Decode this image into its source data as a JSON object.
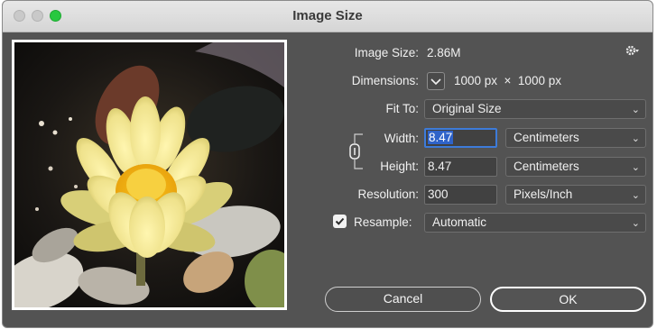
{
  "window": {
    "title": "Image Size"
  },
  "info": {
    "image_size_label": "Image Size:",
    "image_size_value": "2.86M",
    "dimensions_label": "Dimensions:",
    "dimensions_value": "1000 px  ×  1000 px"
  },
  "fit_to": {
    "label": "Fit To:",
    "value": "Original Size"
  },
  "width": {
    "label": "Width:",
    "value": "8.47",
    "unit": "Centimeters"
  },
  "height": {
    "label": "Height:",
    "value": "8.47",
    "unit": "Centimeters"
  },
  "resolution": {
    "label": "Resolution:",
    "value": "300",
    "unit": "Pixels/Inch"
  },
  "resample": {
    "label": "Resample:",
    "checked": true,
    "value": "Automatic"
  },
  "buttons": {
    "cancel": "Cancel",
    "ok": "OK"
  },
  "icons": {
    "gear": "gear-icon",
    "link": "link-constrain-icon",
    "chevron": "chevron-down-icon",
    "check": "checkmark-icon"
  },
  "colors": {
    "dialog_bg": "#535353",
    "focus_ring": "#3d7bd9",
    "maximize": "#28c840"
  }
}
